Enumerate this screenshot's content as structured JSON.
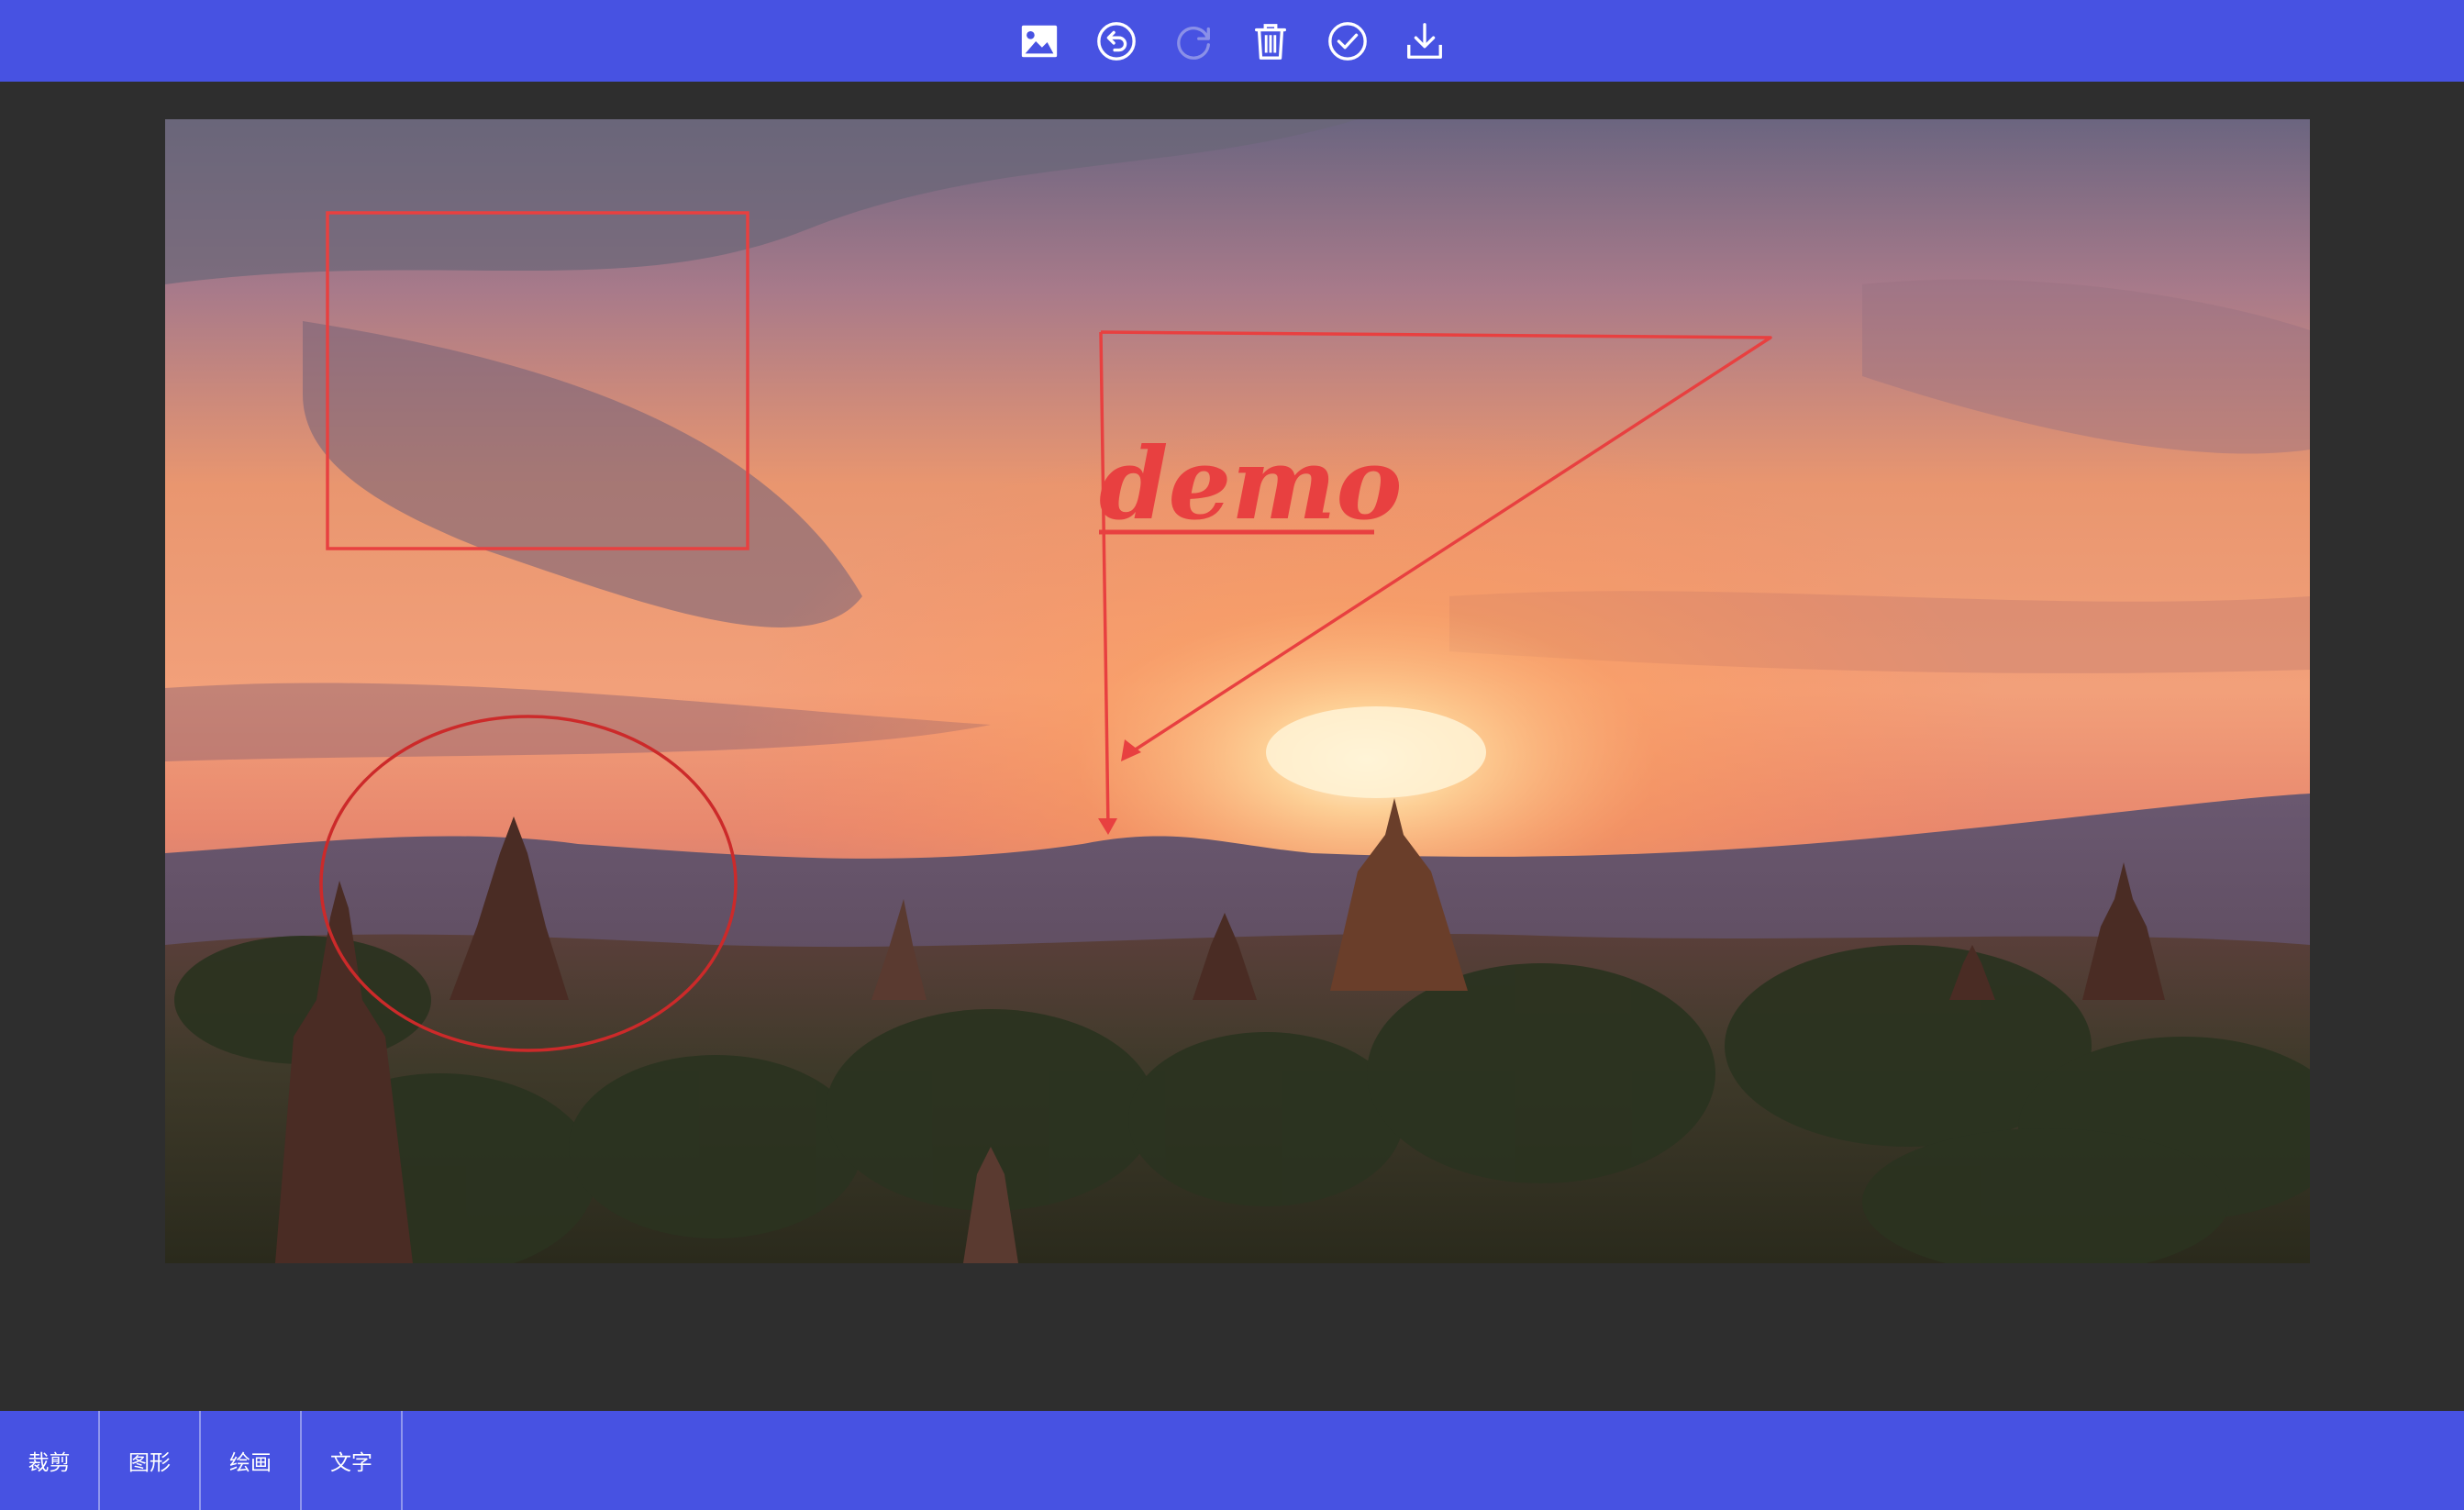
{
  "toolbar": {
    "buttons": [
      {
        "name": "open-image",
        "icon": "image-icon"
      },
      {
        "name": "undo",
        "icon": "undo-icon"
      },
      {
        "name": "redo",
        "icon": "redo-icon",
        "disabled": true
      },
      {
        "name": "delete",
        "icon": "trash-icon"
      },
      {
        "name": "confirm",
        "icon": "check-circle-icon"
      },
      {
        "name": "download",
        "icon": "download-icon"
      }
    ]
  },
  "canvas": {
    "annotation_text": "demo",
    "annotation_color": "#e84040",
    "shapes": [
      "rectangle",
      "triangle-arrow-path",
      "ellipse"
    ]
  },
  "tabs": [
    {
      "label": "裁剪"
    },
    {
      "label": "图形"
    },
    {
      "label": "绘画"
    },
    {
      "label": "文字"
    }
  ],
  "colors": {
    "bar": "#4752e2",
    "background": "#2e2e2e",
    "annotation": "#e84040"
  }
}
